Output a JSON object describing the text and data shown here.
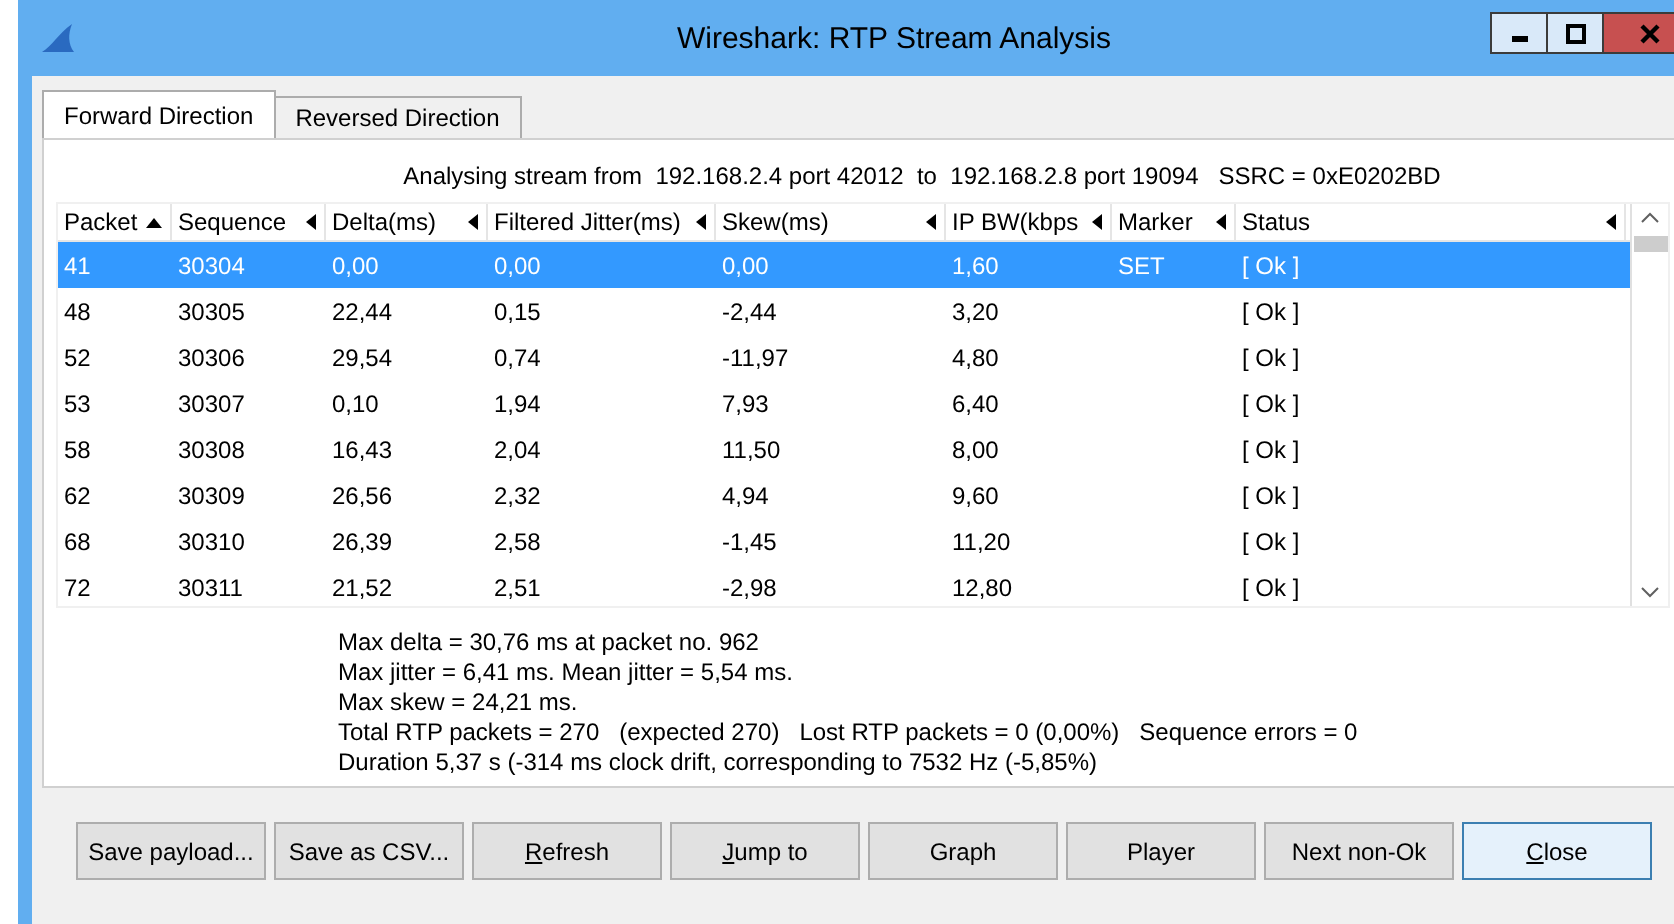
{
  "window": {
    "title": "Wireshark: RTP Stream Analysis"
  },
  "tabs": [
    {
      "label": "Forward Direction",
      "selected": true
    },
    {
      "label": "Reversed Direction",
      "selected": false
    }
  ],
  "stream_info": "Analysing stream from  192.168.2.4 port 42012  to  192.168.2.8 port 19094   SSRC = 0xE0202BD",
  "table": {
    "columns": [
      {
        "label": "Packet",
        "sorted": true
      },
      {
        "label": "Sequence",
        "sorted": false
      },
      {
        "label": "Delta(ms)",
        "sorted": false
      },
      {
        "label": "Filtered Jitter(ms)",
        "sorted": false
      },
      {
        "label": "Skew(ms)",
        "sorted": false
      },
      {
        "label": "IP BW(kbps",
        "sorted": false
      },
      {
        "label": "Marker",
        "sorted": false
      },
      {
        "label": "Status",
        "sorted": false
      }
    ],
    "rows": [
      {
        "cells": [
          "41",
          "30304",
          "0,00",
          "0,00",
          "0,00",
          "1,60",
          "SET",
          "[ Ok ]"
        ],
        "selected": true
      },
      {
        "cells": [
          "48",
          "30305",
          "22,44",
          "0,15",
          "-2,44",
          "3,20",
          "",
          "[ Ok ]"
        ],
        "selected": false
      },
      {
        "cells": [
          "52",
          "30306",
          "29,54",
          "0,74",
          "-11,97",
          "4,80",
          "",
          "[ Ok ]"
        ],
        "selected": false
      },
      {
        "cells": [
          "53",
          "30307",
          "0,10",
          "1,94",
          "7,93",
          "6,40",
          "",
          "[ Ok ]"
        ],
        "selected": false
      },
      {
        "cells": [
          "58",
          "30308",
          "16,43",
          "2,04",
          "11,50",
          "8,00",
          "",
          "[ Ok ]"
        ],
        "selected": false
      },
      {
        "cells": [
          "62",
          "30309",
          "26,56",
          "2,32",
          "4,94",
          "9,60",
          "",
          "[ Ok ]"
        ],
        "selected": false
      },
      {
        "cells": [
          "68",
          "30310",
          "26,39",
          "2,58",
          "-1,45",
          "11,20",
          "",
          "[ Ok ]"
        ],
        "selected": false
      },
      {
        "cells": [
          "72",
          "30311",
          "21,52",
          "2,51",
          "-2,98",
          "12,80",
          "",
          "[ Ok ]"
        ],
        "selected": false
      }
    ]
  },
  "summary": [
    "Max delta = 30,76 ms at packet no. 962",
    "Max jitter = 6,41 ms. Mean jitter = 5,54 ms.",
    "Max skew = 24,21 ms.",
    "Total RTP packets = 270   (expected 270)   Lost RTP packets = 0 (0,00%)   Sequence errors = 0",
    "Duration 5,37 s (-314 ms clock drift, corresponding to 7532 Hz (-5,85%)"
  ],
  "buttons": [
    {
      "label": "Save payload...",
      "mnemonic": false,
      "default": false
    },
    {
      "label": "Save as CSV...",
      "mnemonic": false,
      "default": false
    },
    {
      "label": "Refresh",
      "mnemonic": true,
      "default": false
    },
    {
      "label": "Jump to",
      "mnemonic": true,
      "default": false
    },
    {
      "label": "Graph",
      "mnemonic": false,
      "default": false
    },
    {
      "label": "Player",
      "mnemonic": false,
      "default": false
    },
    {
      "label": "Next non-Ok",
      "mnemonic": false,
      "default": false
    },
    {
      "label": "Close",
      "mnemonic": true,
      "default": true
    }
  ]
}
